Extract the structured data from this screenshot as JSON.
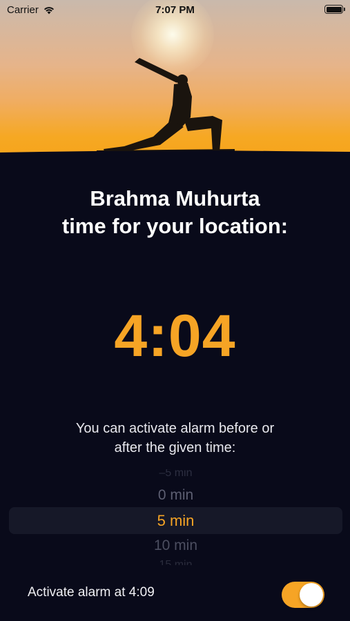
{
  "status_bar": {
    "carrier": "Carrier",
    "time": "7:07 PM"
  },
  "hero": {
    "sky_colors": [
      "#c9b9ac",
      "#f0ad62",
      "#f7a51c"
    ],
    "silhouette_icon": "yoga-crescent-lunge-silhouette"
  },
  "title": {
    "line1": "Brahma Muhurta",
    "line2": "time for your location:"
  },
  "muhurta_time": "4:04",
  "hint": {
    "line1": "You can activate alarm before or",
    "line2": "after the given time:"
  },
  "picker": {
    "options": [
      "",
      "0 min",
      "5 min",
      "10 min",
      ""
    ],
    "selected": "5 min"
  },
  "alarm": {
    "label": "Activate alarm at 4:09",
    "enabled": true
  },
  "colors": {
    "accent": "#f6a425",
    "background": "#090a1a"
  }
}
